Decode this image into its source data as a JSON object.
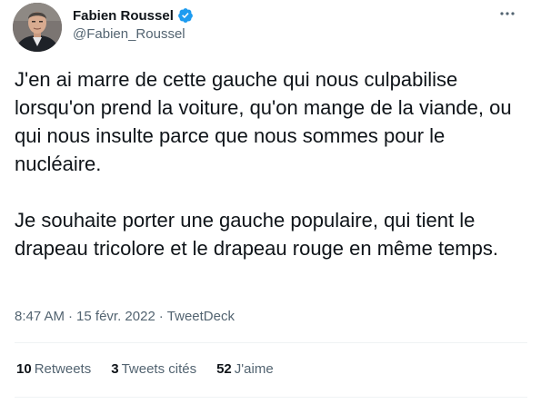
{
  "author": {
    "display_name": "Fabien Roussel",
    "handle": "@Fabien_Roussel",
    "verified": true,
    "verified_color": "#1d9bf0"
  },
  "tweet": {
    "paragraphs": [
      "J'en ai marre de cette gauche qui nous culpabilise lorsqu'on prend la voiture, qu'on mange de la viande, ou qui nous insulte parce que nous sommes pour le nucléaire.",
      "Je souhaite porter une gauche populaire, qui tient le drapeau tricolore et le drapeau rouge en même temps."
    ],
    "time": "8:47 AM",
    "date": "15 févr. 2022",
    "separator": "·",
    "source": "TweetDeck"
  },
  "stats": {
    "retweets": {
      "count": "10",
      "label": "Retweets"
    },
    "quotes": {
      "count": "3",
      "label": "Tweets cités"
    },
    "likes": {
      "count": "52",
      "label": "J'aime"
    }
  },
  "icons": {
    "more": "more-horizontal-icon",
    "verified": "verified-badge-icon"
  },
  "colors": {
    "text_primary": "#0f1419",
    "text_secondary": "#536471",
    "divider": "#eff3f4"
  }
}
